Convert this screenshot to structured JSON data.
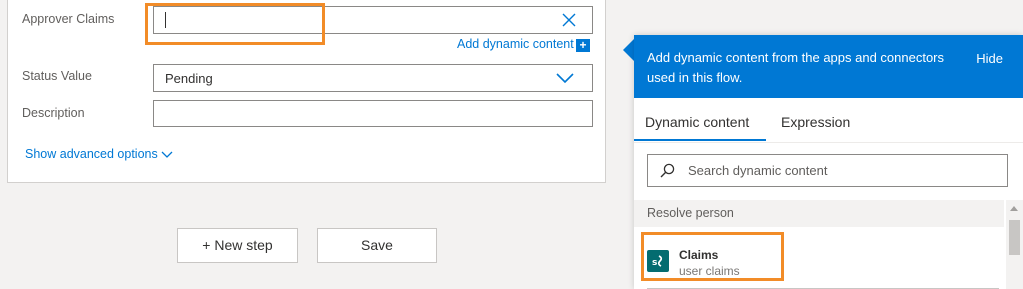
{
  "form": {
    "approver_claims_label": "Approver Claims",
    "approver_claims_value": "",
    "add_dynamic_content": "Add dynamic content",
    "status_value_label": "Status Value",
    "status_value_selected": "Pending",
    "description_label": "Description",
    "description_value": "",
    "show_advanced_options": "Show advanced options"
  },
  "buttons": {
    "new_step": "+ New step",
    "save": "Save"
  },
  "dynamic_panel": {
    "header_text": "Add dynamic content from the apps and connectors used in this flow.",
    "hide": "Hide",
    "tabs": [
      {
        "label": "Dynamic content",
        "active": true
      },
      {
        "label": "Expression",
        "active": false
      }
    ],
    "search_placeholder": "Search dynamic content",
    "section_title": "Resolve person",
    "items": [
      {
        "title": "Claims",
        "subtitle": "user claims",
        "icon": "sharepoint-icon"
      }
    ]
  },
  "colors": {
    "accent": "#0078d4",
    "highlight": "#f28c28",
    "sharepoint": "#036c70"
  }
}
